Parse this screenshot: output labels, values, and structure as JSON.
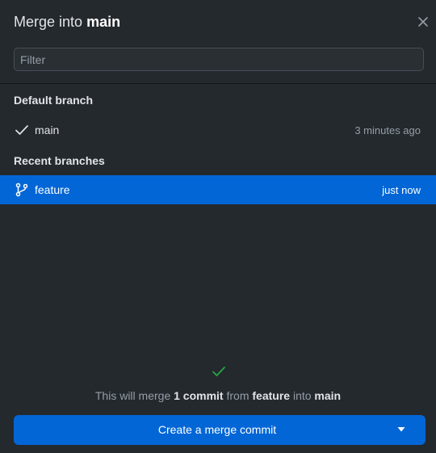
{
  "dialog": {
    "title_prefix": "Merge into",
    "title_branch": "main",
    "close_icon": "close-icon"
  },
  "filter": {
    "placeholder": "Filter",
    "value": ""
  },
  "default_branch": {
    "header": "Default branch",
    "items": [
      {
        "name": "main",
        "time": "3 minutes ago",
        "icon": "check-icon",
        "selected": false
      }
    ]
  },
  "recent_branches": {
    "header": "Recent branches",
    "items": [
      {
        "name": "feature",
        "time": "just now",
        "icon": "git-branch-icon",
        "selected": true
      }
    ]
  },
  "footer": {
    "status_icon": "check-icon",
    "summary": {
      "pre": "This will merge",
      "commit_count": "1 commit",
      "from_word": "from",
      "source_branch": "feature",
      "into_word": "into",
      "target_branch": "main"
    },
    "merge_button_label": "Create a merge commit",
    "merge_dropdown_icon": "caret-down-icon"
  },
  "colors": {
    "background": "#24292e",
    "accent": "#0366d6",
    "success": "#28a745",
    "muted_text": "#959da5"
  }
}
